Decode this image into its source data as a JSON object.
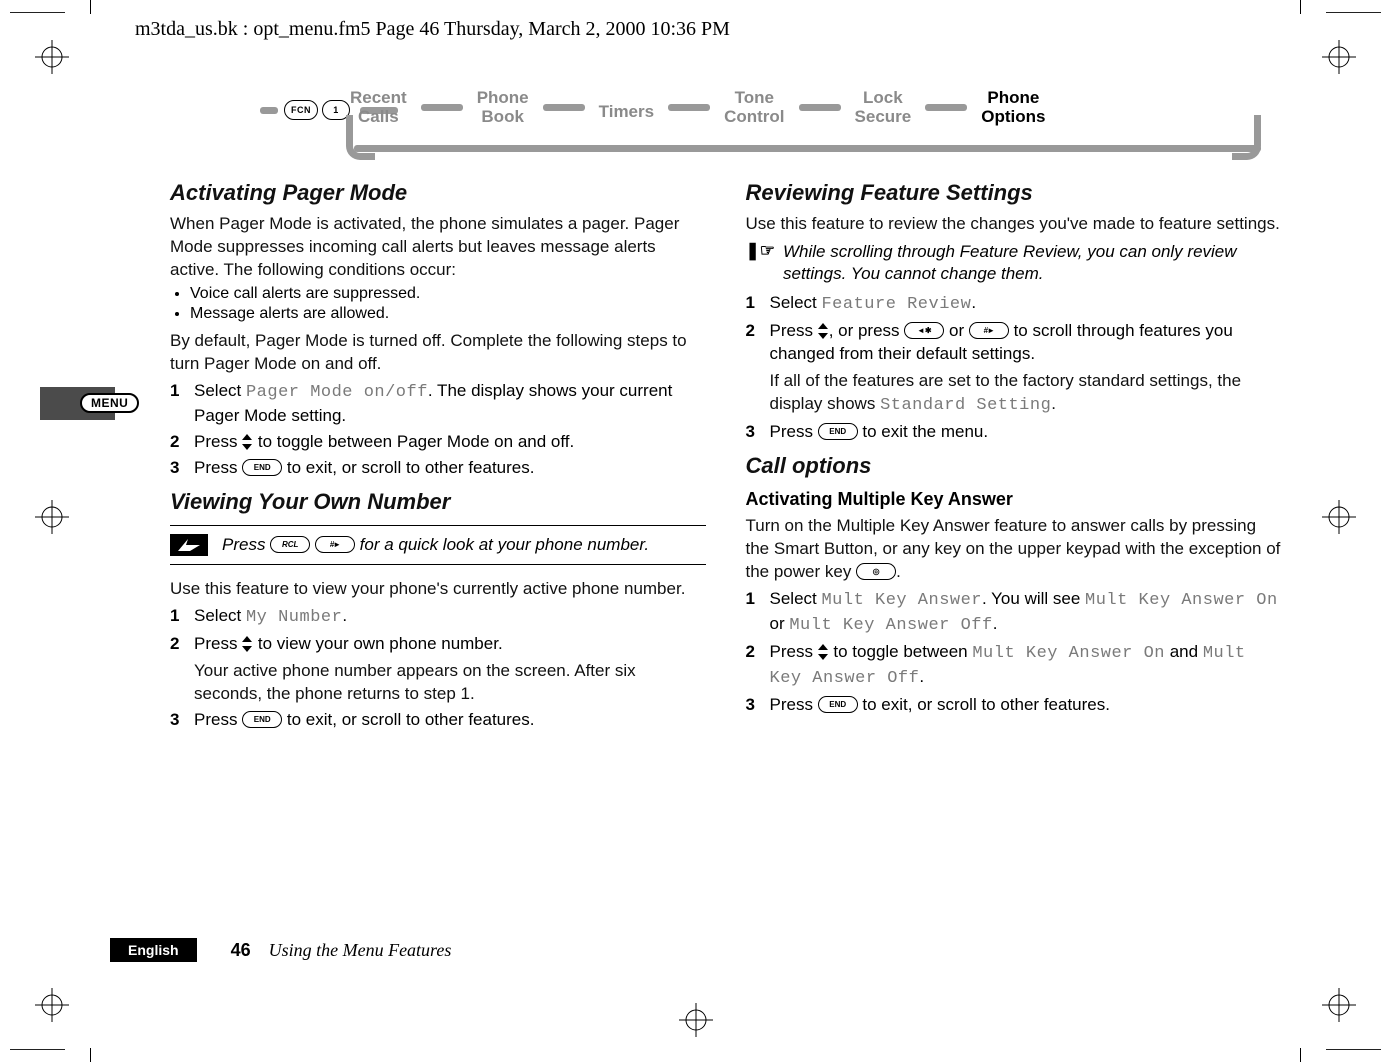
{
  "header_path": "m3tda_us.bk : opt_menu.fm5  Page 46  Thursday, March 2, 2000  10:36 PM",
  "nav": {
    "keys": "FCN 1",
    "items": [
      "Recent Calls",
      "Phone Book",
      "Timers",
      "Tone Control",
      "Lock Secure",
      "Phone Options"
    ],
    "active_index": 5
  },
  "menu_tab": "MENU",
  "left": {
    "h_pager": "Activating Pager Mode",
    "pager_intro": "When Pager Mode is activated, the phone simulates a pager. Pager Mode suppresses incoming call alerts but leaves message alerts active. The following conditions occur:",
    "pager_b1": "Voice call alerts are suppressed.",
    "pager_b2": "Message alerts are allowed.",
    "pager_default": "By default, Pager Mode is turned off. Complete the following steps to turn Pager Mode on and off.",
    "pager_s1a": "Select ",
    "pager_s1_mono": "Pager Mode on/off",
    "pager_s1b": ". The display shows your current Pager Mode setting.",
    "pager_s2a": "Press ",
    "pager_s2b": " to toggle between Pager Mode on and off.",
    "pager_s3a": "Press ",
    "pager_s3_pill": "END",
    "pager_s3b": " to exit, or scroll to other features.",
    "h_own": "Viewing Your Own Number",
    "own_tip_a": "Press ",
    "own_tip_pill1": "RCL",
    "own_tip_pill2": "#►",
    "own_tip_b": " for a quick look at your phone number.",
    "own_intro": "Use this feature to view your phone's currently active phone number.",
    "own_s1a": "Select ",
    "own_s1_mono": "My Number",
    "own_s1b": ".",
    "own_s2a": "Press ",
    "own_s2b": " to view your own phone number.",
    "own_s2_note": "Your active phone number appears on the screen. After six seconds, the phone returns to step 1.",
    "own_s3a": "Press ",
    "own_s3_pill": "END",
    "own_s3b": " to exit, or scroll to other features."
  },
  "right": {
    "h_review": "Reviewing Feature Settings",
    "review_intro": "Use this feature to review the changes you've made to feature settings.",
    "review_note": "While scrolling through Feature Review, you can only review settings. You cannot change them.",
    "review_s1a": "Select ",
    "review_s1_mono": "Feature Review",
    "review_s1b": ".",
    "review_s2a": "Press ",
    "review_s2b": ", or press ",
    "review_s2c": " or ",
    "review_s2d": " to scroll through features you changed from their default settings.",
    "review_s2_note_a": "If all of the features are set to the factory standard settings, the display shows ",
    "review_s2_note_mono": "Standard Setting",
    "review_s2_note_b": ".",
    "review_s3a": "Press ",
    "review_s3_pill": "END",
    "review_s3b": " to exit the menu.",
    "h_call": "Call options",
    "h_mka": "Activating Multiple Key Answer",
    "mka_intro_a": "Turn on the Multiple Key Answer feature to answer calls by pressing the Smart Button, or any key on the upper keypad with the exception of the power key ",
    "mka_intro_b": ".",
    "mka_s1a": "Select ",
    "mka_s1_mono1": "Mult Key Answer",
    "mka_s1b": ". You will see ",
    "mka_s1_mono2": "Mult Key Answer On",
    "mka_s1c": " or ",
    "mka_s1_mono3": "Mult Key Answer Off",
    "mka_s1d": ".",
    "mka_s2a": "Press ",
    "mka_s2b": " to toggle between ",
    "mka_s2_mono1": "Mult Key Answer On",
    "mka_s2c": " and ",
    "mka_s2_mono2": "Mult Key Answer Off",
    "mka_s2d": ".",
    "mka_s3a": "Press ",
    "mka_s3_pill": "END",
    "mka_s3b": " to exit, or scroll to other features."
  },
  "footer": {
    "lang": "English",
    "page": "46",
    "title": "Using the Menu Features"
  }
}
